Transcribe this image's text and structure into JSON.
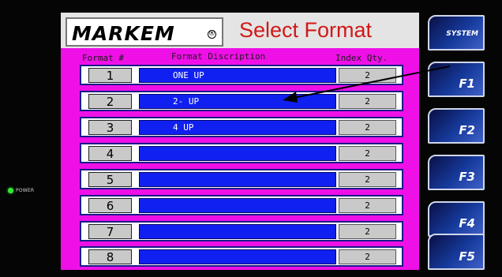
{
  "power": {
    "label": "POWER",
    "led_color": "#37e637"
  },
  "header": {
    "logo_text": "MARKEM",
    "logo_mark": "®",
    "title": "Select Format"
  },
  "columns": {
    "format_num": "Format #",
    "description": "Format Discription",
    "index_qty": "Index Qty."
  },
  "formats": [
    {
      "num": "1",
      "desc": "ONE UP",
      "qty": "2"
    },
    {
      "num": "2",
      "desc": "2- UP",
      "qty": "2"
    },
    {
      "num": "3",
      "desc": "4 UP",
      "qty": "2"
    },
    {
      "num": "4",
      "desc": "",
      "qty": "2"
    },
    {
      "num": "5",
      "desc": "",
      "qty": "2"
    },
    {
      "num": "6",
      "desc": "",
      "qty": "2"
    },
    {
      "num": "7",
      "desc": "",
      "qty": "2"
    },
    {
      "num": "8",
      "desc": "",
      "qty": "2"
    }
  ],
  "function_keys": [
    {
      "label": "SYSTEM"
    },
    {
      "label": "F1"
    },
    {
      "label": "F2"
    },
    {
      "label": "F3"
    },
    {
      "label": "F4"
    },
    {
      "label": "F5"
    }
  ],
  "colors": {
    "screen_bg": "#ee10e6",
    "title_red": "#d11818",
    "desc_blue": "#1020f0"
  }
}
